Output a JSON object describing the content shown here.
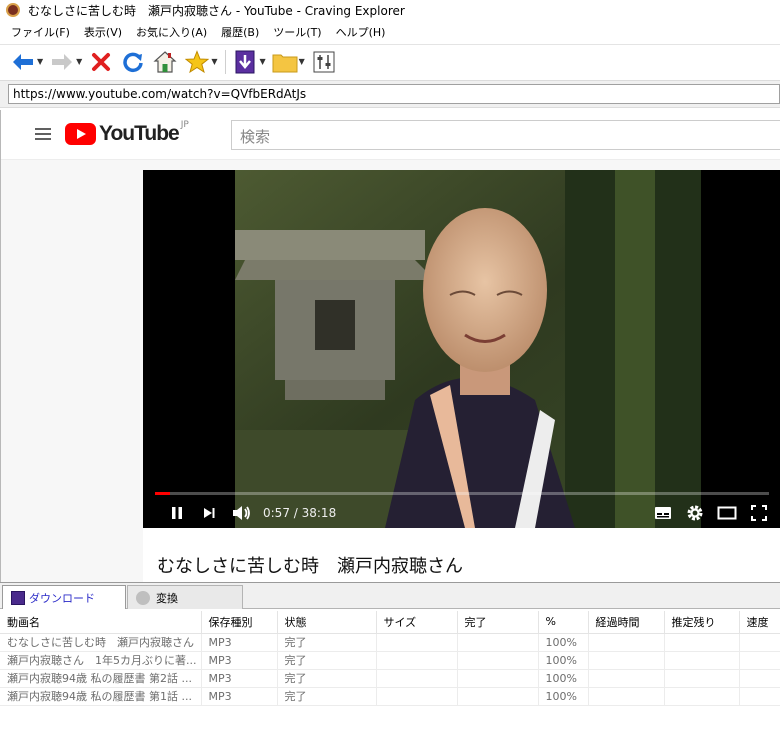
{
  "window": {
    "title": "むなしさに苦しむ時　瀬戸内寂聴さん - YouTube - Craving Explorer"
  },
  "menu": [
    "ファイル(F)",
    "表示(V)",
    "お気に入り(A)",
    "履歴(B)",
    "ツール(T)",
    "ヘルプ(H)"
  ],
  "toolbar": {
    "icons": [
      "back-arrow-icon",
      "forward-arrow-icon",
      "stop-x-icon",
      "refresh-icon",
      "home-icon",
      "favorite-star-icon",
      "download-icon",
      "folder-icon",
      "settings-sliders-icon"
    ]
  },
  "address": {
    "url": "https://www.youtube.com/watch?v=QVfbERdAtJs"
  },
  "youtube": {
    "brand": "YouTube",
    "region": "JP",
    "search_placeholder": "検索",
    "player": {
      "time": "0:57 / 38:18",
      "progress_fraction": 0.025
    },
    "video_title": "むなしさに苦しむ時　瀬戸内寂聴さん"
  },
  "colors": {
    "accent_red": "#ff0000",
    "tab_active_text": "#2a2ac8"
  },
  "panel": {
    "tabs": [
      {
        "label": "ダウンロード",
        "active": true
      },
      {
        "label": "変換",
        "active": false
      }
    ],
    "columns": [
      "動画名",
      "保存種別",
      "状態",
      "サイズ",
      "完了",
      "%",
      "経過時間",
      "推定残り",
      "速度"
    ],
    "rows": [
      {
        "name": "むなしさに苦しむ時　瀬戸内寂聴さん",
        "type": "MP3",
        "status": "完了",
        "size": "",
        "done": "",
        "percent": "100%",
        "elapsed": "",
        "remaining": "",
        "speed": ""
      },
      {
        "name": "瀬戸内寂聴さん　1年5カ月ぶりに著...",
        "type": "MP3",
        "status": "完了",
        "size": "",
        "done": "",
        "percent": "100%",
        "elapsed": "",
        "remaining": "",
        "speed": ""
      },
      {
        "name": "瀬戸内寂聴94歳 私の履歴書 第2話 ...",
        "type": "MP3",
        "status": "完了",
        "size": "",
        "done": "",
        "percent": "100%",
        "elapsed": "",
        "remaining": "",
        "speed": ""
      },
      {
        "name": "瀬戸内寂聴94歳 私の履歴書 第1話 ...",
        "type": "MP3",
        "status": "完了",
        "size": "",
        "done": "",
        "percent": "100%",
        "elapsed": "",
        "remaining": "",
        "speed": ""
      }
    ]
  }
}
